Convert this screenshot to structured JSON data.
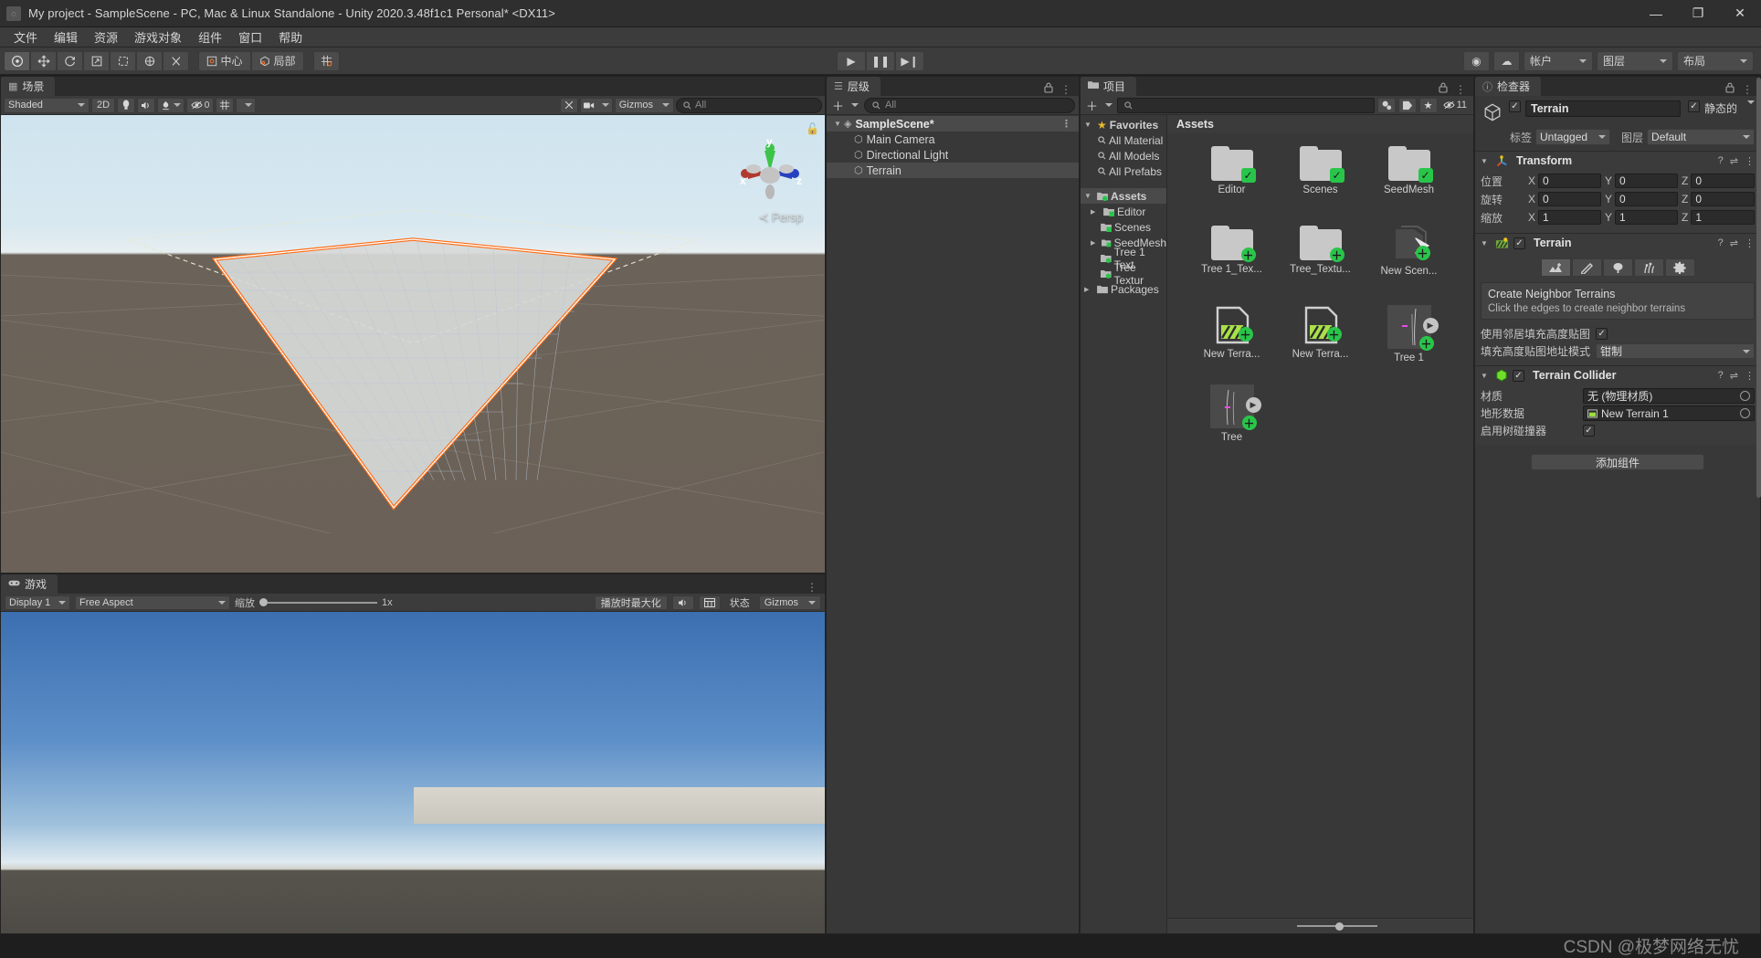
{
  "window": {
    "title": "My project - SampleScene - PC, Mac & Linux Standalone - Unity 2020.3.48f1c1 Personal* <DX11>",
    "minimize": "—",
    "maximize": "❐",
    "close": "✕"
  },
  "menubar": {
    "items": [
      "文件",
      "编辑",
      "资源",
      "游戏对象",
      "组件",
      "窗口",
      "帮助"
    ]
  },
  "toolbar": {
    "transform_tools": [
      {
        "name": "hand-tool",
        "glyph": "✋",
        "selected": true
      },
      {
        "name": "move-tool",
        "glyph": "✥",
        "selected": false
      },
      {
        "name": "rotate-tool",
        "glyph": "↻",
        "selected": false
      },
      {
        "name": "scale-tool",
        "glyph": "⤢",
        "selected": false
      },
      {
        "name": "rect-tool",
        "glyph": "⬚",
        "selected": false
      },
      {
        "name": "transform-tool",
        "glyph": "✧",
        "selected": false
      },
      {
        "name": "custom-tool",
        "glyph": "⚒",
        "selected": false
      }
    ],
    "pivot_label": "中心",
    "space_label": "局部",
    "grid_snap_glyph": "▦",
    "play": "▶",
    "pause": "❚❚",
    "step": "▶❙",
    "collab_glyph": "◉",
    "cloud_glyph": "☁",
    "account_label": "帐户",
    "layers_label": "图层",
    "layout_label": "布局"
  },
  "scene": {
    "tab_label": "场景",
    "tab_icon": "▦",
    "shading": "Shaded",
    "mode_2d": "2D",
    "light_glyph": "💡",
    "audio_glyph": "🔊",
    "fx_glyph": "✿",
    "hidden_count": "0",
    "grid_glyph": "▦",
    "tools_glyph": "✂",
    "camera_glyph": "◧",
    "gizmos_label": "Gizmos",
    "search_placeholder": "All",
    "persp_label": "Persp",
    "axis_x": "x",
    "axis_y": "y",
    "axis_z": "z"
  },
  "game": {
    "tab_label": "游戏",
    "tab_icon": "🎮",
    "display": "Display 1",
    "aspect": "Free Aspect",
    "scale_label": "缩放",
    "scale_value": "1x",
    "maximize_on_play": "播放时最大化",
    "mute_glyph": "🔊",
    "stats_glyph": "▤",
    "stats_label": "状态",
    "gizmos_label": "Gizmos"
  },
  "hierarchy": {
    "tab_label": "层级",
    "tab_icon": "☰",
    "add_glyph": "＋",
    "search_placeholder": "All",
    "lock_glyph": "🔒",
    "kebab_glyph": "⋮",
    "scene_name": "SampleScene*",
    "items": [
      {
        "label": "Main Camera",
        "selected": false
      },
      {
        "label": "Directional Light",
        "selected": false
      },
      {
        "label": "Terrain",
        "selected": true
      }
    ]
  },
  "project": {
    "tab_label": "项目",
    "tab_icon": "📁",
    "add_glyph": "＋",
    "search_placeholder": "",
    "filter_type_glyph": "◔",
    "filter_label_glyph": "🏷",
    "favorite_glyph": "★",
    "hidden_glyph": "👁",
    "hidden_count": "11",
    "breadcrumb": "Assets",
    "tree": [
      {
        "label": "Favorites",
        "kind": "favorites",
        "depth": 0,
        "expanded": true
      },
      {
        "label": "All Material",
        "kind": "search",
        "depth": 1
      },
      {
        "label": "All Models",
        "kind": "search",
        "depth": 1
      },
      {
        "label": "All Prefabs",
        "kind": "search",
        "depth": 1
      },
      {
        "label": "Assets",
        "kind": "folder-mod",
        "depth": 0,
        "expanded": true,
        "selected": true
      },
      {
        "label": "Editor",
        "kind": "folder-mod",
        "depth": 1,
        "expandable": true
      },
      {
        "label": "Scenes",
        "kind": "folder-mod",
        "depth": 1
      },
      {
        "label": "SeedMesh",
        "kind": "folder-mod",
        "depth": 1,
        "expandable": true
      },
      {
        "label": "Tree 1 Text",
        "kind": "folder-add",
        "depth": 1
      },
      {
        "label": "Tree Textur",
        "kind": "folder-add",
        "depth": 1
      },
      {
        "label": "Packages",
        "kind": "folder",
        "depth": 0,
        "expandable": true
      }
    ],
    "assets": [
      {
        "label": "Editor",
        "icon": "folder",
        "badge": "mod"
      },
      {
        "label": "Scenes",
        "icon": "folder",
        "badge": "mod"
      },
      {
        "label": "SeedMesh",
        "icon": "folder",
        "badge": "mod"
      },
      {
        "label": "Tree 1_Tex...",
        "icon": "folder",
        "badge": "add"
      },
      {
        "label": "Tree_Textu...",
        "icon": "folder",
        "badge": "add"
      },
      {
        "label": "New Scen...",
        "icon": "unity-scene",
        "badge": "add"
      },
      {
        "label": "New Terra...",
        "icon": "terrain-data",
        "badge": "add"
      },
      {
        "label": "New Terra...",
        "icon": "terrain-data",
        "badge": "add"
      },
      {
        "label": "Tree 1",
        "icon": "texture",
        "badge": "add",
        "has_play": true
      },
      {
        "label": "Tree",
        "icon": "texture",
        "badge": "add",
        "has_play": true
      }
    ]
  },
  "inspector": {
    "tab_label": "检查器",
    "tab_icon": "ⓘ",
    "lock_glyph": "🔒",
    "kebab_glyph": "⋮",
    "object_name": "Terrain",
    "enabled": true,
    "static_label": "静态的",
    "static_checked": true,
    "tag_label": "标签",
    "tag_value": "Untagged",
    "layer_label": "图层",
    "layer_value": "Default",
    "transform": {
      "title": "Transform",
      "rows": [
        {
          "label": "位置",
          "x": "0",
          "y": "0",
          "z": "0"
        },
        {
          "label": "旋转",
          "x": "0",
          "y": "0",
          "z": "0"
        },
        {
          "label": "缩放",
          "x": "1",
          "y": "1",
          "z": "1"
        }
      ],
      "axes": [
        "X",
        "Y",
        "Z"
      ]
    },
    "terrain": {
      "title": "Terrain",
      "enabled": true,
      "tabs": [
        {
          "name": "create-neighbor-terrains-tab",
          "glyph": "⛰",
          "selected": true
        },
        {
          "name": "paint-terrain-tab",
          "glyph": "✎",
          "selected": false
        },
        {
          "name": "paint-trees-tab",
          "glyph": "🌳",
          "selected": false
        },
        {
          "name": "paint-details-tab",
          "glyph": "🌿",
          "selected": false
        },
        {
          "name": "terrain-settings-tab",
          "glyph": "⚙",
          "selected": false
        }
      ],
      "info_title": "Create Neighbor Terrains",
      "info_text": "Click the edges to create neighbor terrains",
      "fill_heightmap_label": "使用邻居填充高度贴图",
      "fill_heightmap_checked": true,
      "address_mode_label": "填充高度贴图地址模式",
      "address_mode_value": "钳制"
    },
    "terrain_collider": {
      "title": "Terrain Collider",
      "enabled": true,
      "material_label": "材质",
      "material_value": "无 (物理材质)",
      "terrain_data_label": "地形数据",
      "terrain_data_value": "New Terrain 1",
      "tree_collider_label": "启用树碰撞器",
      "tree_collider_checked": true
    },
    "add_component_label": "添加组件",
    "help_glyph": "?",
    "preset_glyph": "⇌",
    "menu_glyph": "⋮"
  },
  "statusbar": {
    "watermark": "CSDN @极梦网络无忧"
  },
  "colors": {
    "selection_outline": "#ff6a10",
    "accent_green": "#29c54a",
    "panel_bg": "#383838",
    "chrome_bg": "#3c3c3c"
  }
}
